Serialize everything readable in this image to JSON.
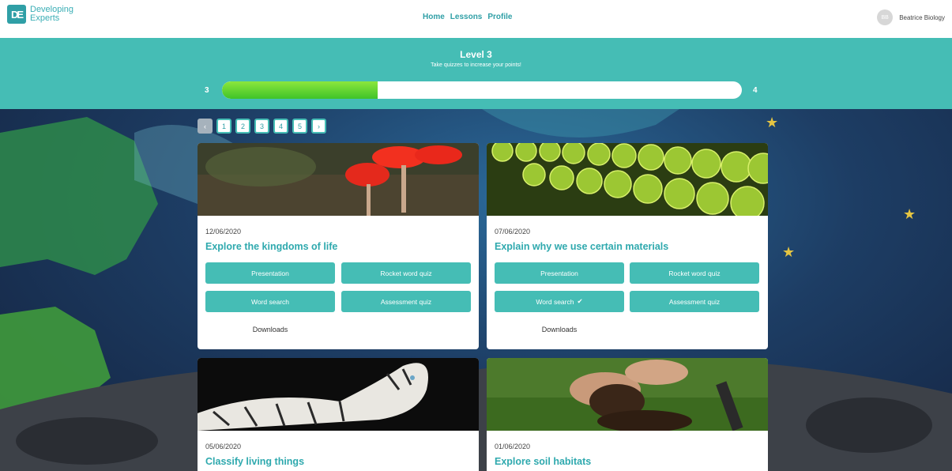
{
  "header": {
    "logo_mark": "DE",
    "logo_line1": "Developing",
    "logo_line2": "Experts",
    "nav": [
      "Home",
      "Lessons",
      "Profile"
    ],
    "avatar_initials": "BB",
    "username": "Beatrice Biology"
  },
  "level": {
    "title": "Level 3",
    "subtitle": "Take quizzes to increase your points!",
    "current": "3",
    "next": "4",
    "progress_fraction": 0.3
  },
  "pagination": {
    "prev": "‹",
    "pages": [
      "1",
      "2",
      "3",
      "4",
      "5"
    ],
    "next": "›"
  },
  "cards": [
    {
      "date": "12/06/2020",
      "title": "Explore the kingdoms of life",
      "buttons": [
        "Presentation",
        "Rocket word quiz",
        "Word search",
        "Assessment quiz"
      ],
      "downloads": "Downloads"
    },
    {
      "date": "07/06/2020",
      "title": "Explain why we use certain materials",
      "buttons": [
        "Presentation",
        "Rocket word quiz",
        "Word search",
        "Assessment quiz"
      ],
      "word_search_done": "✔",
      "downloads": "Downloads"
    },
    {
      "date": "05/06/2020",
      "title": "Classify living things"
    },
    {
      "date": "01/06/2020",
      "title": "Explore soil habitats"
    }
  ],
  "colors": {
    "brand_teal": "#45bdb5",
    "title_teal": "#2fa9ae",
    "progress_green": "#52cf2e",
    "star_yellow": "#e5c542"
  }
}
